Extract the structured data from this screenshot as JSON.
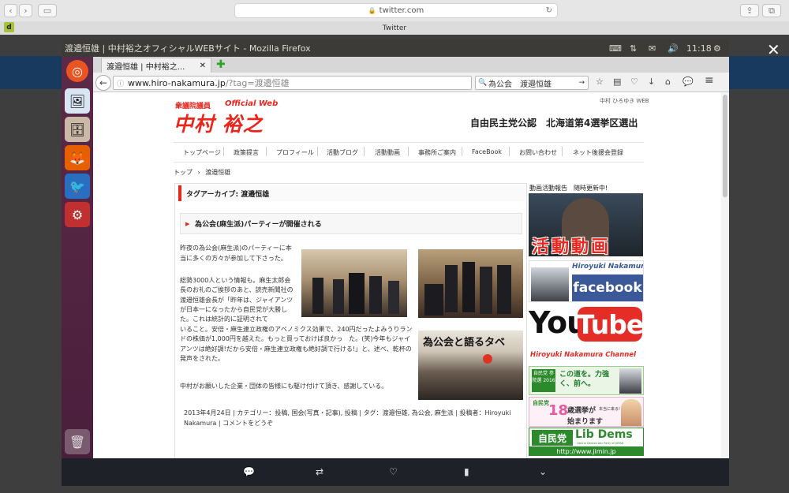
{
  "safari": {
    "url": "twitter.com",
    "tab_title": "Twitter",
    "badge": "d"
  },
  "ubuntu": {
    "window_title": "渡邉恒雄 | 中村裕之オフィシャルWEBサイト - Mozilla Firefox",
    "clock": "11:18"
  },
  "firefox": {
    "tab_title": "渡邉恒雄 | 中村裕之...",
    "url_domain": "www.hiro-nakamura.jp",
    "url_rest": "/?tag=渡邉恒雄",
    "search_value": "為公会　渡邉恒雄"
  },
  "site": {
    "top_right_label": "中村 ひろゆき WEB",
    "logo_small": "衆議院議員",
    "logo_official": "Official Web",
    "logo_name": "中村 裕之",
    "header_text": "自由民主党公認　北海道第4選挙区選出",
    "nav": [
      "トップページ",
      "政策提言",
      "プロフィール",
      "活動ブログ",
      "活動動画",
      "事務所ご案内",
      "FaceBook",
      "お問い合わせ",
      "ネット後援会登録"
    ],
    "breadcrumb_home": "トップ",
    "breadcrumb_sep": "›",
    "breadcrumb_current": "渡邉恒雄",
    "archive_heading": "タグアーカイブ: 渡邉恒雄",
    "post_title": "為公会(麻生派)パーティーが開催される",
    "post_p1": "昨夜の為公会(麻生派)のパーティーに本当に多くの方々が参加して下さった。",
    "post_p2": "総勢3000人という情報も。麻生太郎会長のお礼のご挨拶のあと、読売新聞社の渡邉恒雄会長が「昨年は、ジャイアンツが日本一になったから自民党が大勝した。これは統計的に証明されていること。安倍・麻生連立政権のアベノミクス効果で、240円だったよみうりランドの株価が1,000円を越えた。もっと買っておけば良かっ　た。(笑)今年もジャイアンツは絶好調!だから安倍・麻生連立政権も絶好調で行ける!」と、述べ、乾杯の発声をされた。",
    "post_p3": "中村がお願いした企業・団体の皆様にも駆け付けて頂き、感謝している。",
    "post_meta": "2013年4月24日 | カテゴリー：投稿, 国会(写真・記事), 投稿 | タグ：渡邉恒雄, 為公会, 麻生派 | 投稿者：Hiroyuki Nakamura | コメントをどうぞ",
    "banner_sign": "為公会と語るタベ",
    "sidebar_heading": "動画活動報告　随時更新中!",
    "banner_video": "活動動画",
    "fb_name": "Hiroyuki Nakamura",
    "fb_word": "facebook",
    "yt_you": "You",
    "yt_tube": "Tube",
    "yt_channel": "Hiroyuki Nakamura Channel",
    "ldp1_badge": "自民党 参院選 2016",
    "ldp1_text": "この道を。力強く、前へ。",
    "ldp2_num": "18",
    "ldp2_text": "歳選挙が",
    "ldp2_small": "本当に来る!",
    "ldp2_text2": "始まります",
    "ldp3_jp": "自民党",
    "ldp3_en": "Lib Dems",
    "ldp3_sub": "Liberal Democratic Party of JAPAN",
    "ldp3_url": "http://www.jimin.jp"
  },
  "colors": {
    "accent_red": "#e8261c",
    "launcher_purple": "#5b2a48",
    "fb_blue": "#3b5998",
    "yt_red": "#e52d27"
  }
}
